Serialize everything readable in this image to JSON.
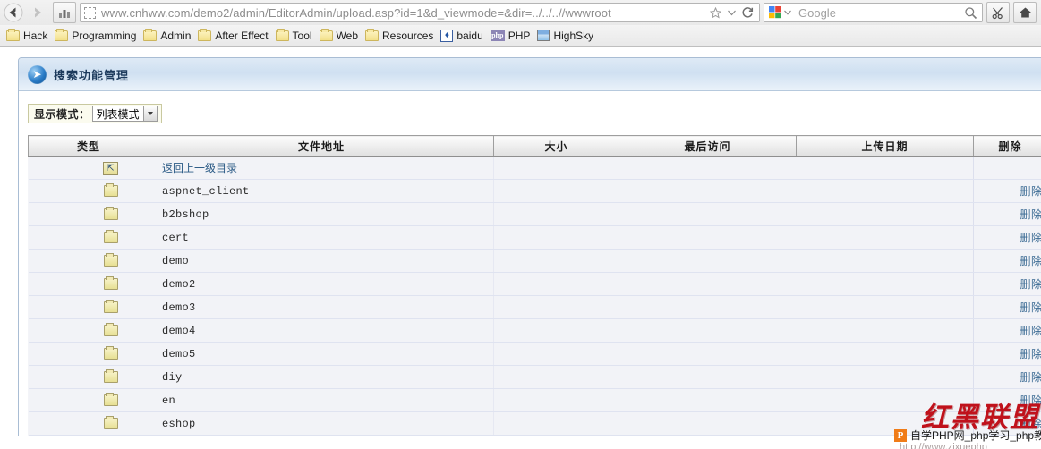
{
  "browser": {
    "back_icon": "back-arrow-icon",
    "forward_icon": "forward-arrow-icon",
    "stats_icon": "bar-chart-icon",
    "url": {
      "host": "www.cnhww.com",
      "path": "/demo2/admin/EditorAdmin/upload.asp?id=1&d_viewmode=&dir=../../..//wwwroot",
      "full": "www.cnhww.com/demo2/admin/EditorAdmin/upload.asp?id=1&d_viewmode=&dir=../../..//wwwroot",
      "favicon": "dotted-square-icon",
      "bookmark_icon": "star-icon",
      "dropdown_icon": "chevron-down-icon",
      "reload_icon": "reload-icon"
    },
    "search": {
      "engine": "google-icon",
      "placeholder": "Google",
      "go_icon": "magnifier-icon"
    },
    "tools": [
      {
        "name": "scissors-icon",
        "label": ""
      },
      {
        "name": "home-icon",
        "label": ""
      }
    ]
  },
  "bookmarks": [
    {
      "label": "Hack",
      "icon": "folder-icon"
    },
    {
      "label": "Programming",
      "icon": "folder-icon"
    },
    {
      "label": "Admin",
      "icon": "folder-icon"
    },
    {
      "label": "After Effect",
      "icon": "folder-icon"
    },
    {
      "label": "Tool",
      "icon": "folder-icon"
    },
    {
      "label": "Web",
      "icon": "folder-icon"
    },
    {
      "label": "Resources",
      "icon": "folder-icon"
    },
    {
      "label": "baidu",
      "icon": "baidu-paw-icon"
    },
    {
      "label": "PHP",
      "icon": "php-icon"
    },
    {
      "label": "HighSky",
      "icon": "highsky-icon"
    }
  ],
  "panel": {
    "title": "搜索功能管理",
    "header_icon": "blue-arrow-icon"
  },
  "toolbar": {
    "viewmode_label": "显示模式：",
    "viewmode_value": "列表模式",
    "viewmode_options": [
      "列表模式"
    ],
    "dropdown_icon": "chevron-down-icon"
  },
  "table": {
    "headers": [
      "类型",
      "文件地址",
      "大小",
      "最后访问",
      "上传日期",
      "删除"
    ],
    "rows": [
      {
        "icon": "up-folder-icon",
        "name": "返回上一级目录",
        "kind": "up",
        "size": "",
        "last_access": "",
        "upload_date": "",
        "delete": ""
      },
      {
        "icon": "folder-icon",
        "name": "aspnet_client",
        "kind": "folder",
        "size": "",
        "last_access": "",
        "upload_date": "",
        "delete": "删除"
      },
      {
        "icon": "folder-icon",
        "name": "b2bshop",
        "kind": "folder",
        "size": "",
        "last_access": "",
        "upload_date": "",
        "delete": "删除"
      },
      {
        "icon": "folder-icon",
        "name": "cert",
        "kind": "folder",
        "size": "",
        "last_access": "",
        "upload_date": "",
        "delete": "删除"
      },
      {
        "icon": "folder-icon",
        "name": "demo",
        "kind": "folder",
        "size": "",
        "last_access": "",
        "upload_date": "",
        "delete": "删除"
      },
      {
        "icon": "folder-icon",
        "name": "demo2",
        "kind": "folder",
        "size": "",
        "last_access": "",
        "upload_date": "",
        "delete": "删除"
      },
      {
        "icon": "folder-icon",
        "name": "demo3",
        "kind": "folder",
        "size": "",
        "last_access": "",
        "upload_date": "",
        "delete": "删除"
      },
      {
        "icon": "folder-icon",
        "name": "demo4",
        "kind": "folder",
        "size": "",
        "last_access": "",
        "upload_date": "",
        "delete": "删除"
      },
      {
        "icon": "folder-icon",
        "name": "demo5",
        "kind": "folder",
        "size": "",
        "last_access": "",
        "upload_date": "",
        "delete": "删除"
      },
      {
        "icon": "folder-icon",
        "name": "diy",
        "kind": "folder",
        "size": "",
        "last_access": "",
        "upload_date": "",
        "delete": "删除"
      },
      {
        "icon": "folder-icon",
        "name": "en",
        "kind": "folder",
        "size": "",
        "last_access": "",
        "upload_date": "",
        "delete": "删除"
      },
      {
        "icon": "folder-icon",
        "name": "eshop",
        "kind": "folder",
        "size": "",
        "last_access": "",
        "upload_date": "",
        "delete": "删除"
      }
    ]
  },
  "watermark": {
    "brand_cn": "红黑联盟",
    "site_text": "自学PHP网_php学习_php教",
    "site_url": "http://www.zixuephp",
    "logo": "P"
  },
  "colors": {
    "link": "#2d5c87",
    "panel_title": "#1c3a5c",
    "watermark_red": "#c0111b",
    "folder_yellow": "#e7df93"
  }
}
